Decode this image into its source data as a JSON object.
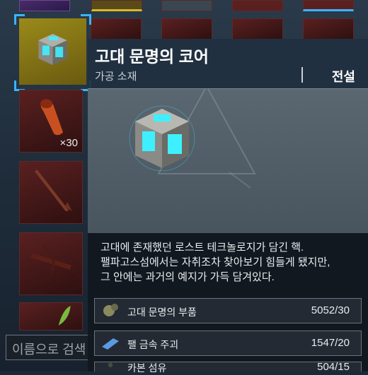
{
  "inventory": {
    "slots": [
      {
        "name": "slot-core",
        "selected": true,
        "qty": ""
      },
      {
        "name": "slot-meat",
        "selected": false,
        "qty": "×30"
      },
      {
        "name": "slot-spear",
        "selected": false,
        "qty": ""
      },
      {
        "name": "slot-crossbow",
        "selected": false,
        "qty": ""
      },
      {
        "name": "slot-leaf",
        "selected": false,
        "qty": ""
      }
    ],
    "search_placeholder": "이름으로 검색"
  },
  "tooltip": {
    "title": "고대 문명의 코어",
    "category": "가공 소재",
    "grade": "전설",
    "description": "고대에 존재했던 로스트 테크놀로지가 담긴 핵.\n팰파고스섬에서는 자취조차 찾아보기 힘들게 됐지만,\n그 안에는 과거의 예지가 가득 담겨있다.",
    "recipe": [
      {
        "name": "고대 문명의 부품",
        "count": "5052/30",
        "icon": "ancient-parts-icon"
      },
      {
        "name": "팰 금속 주괴",
        "count": "1547/20",
        "icon": "pal-metal-ingot-icon"
      },
      {
        "name": "카본 섬유",
        "count": "504/15",
        "icon": "carbon-fiber-icon"
      }
    ]
  },
  "colors": {
    "accent": "#3ab4ff",
    "selected_slot": "#9a8a1a",
    "glow": "#3ef0ff"
  }
}
